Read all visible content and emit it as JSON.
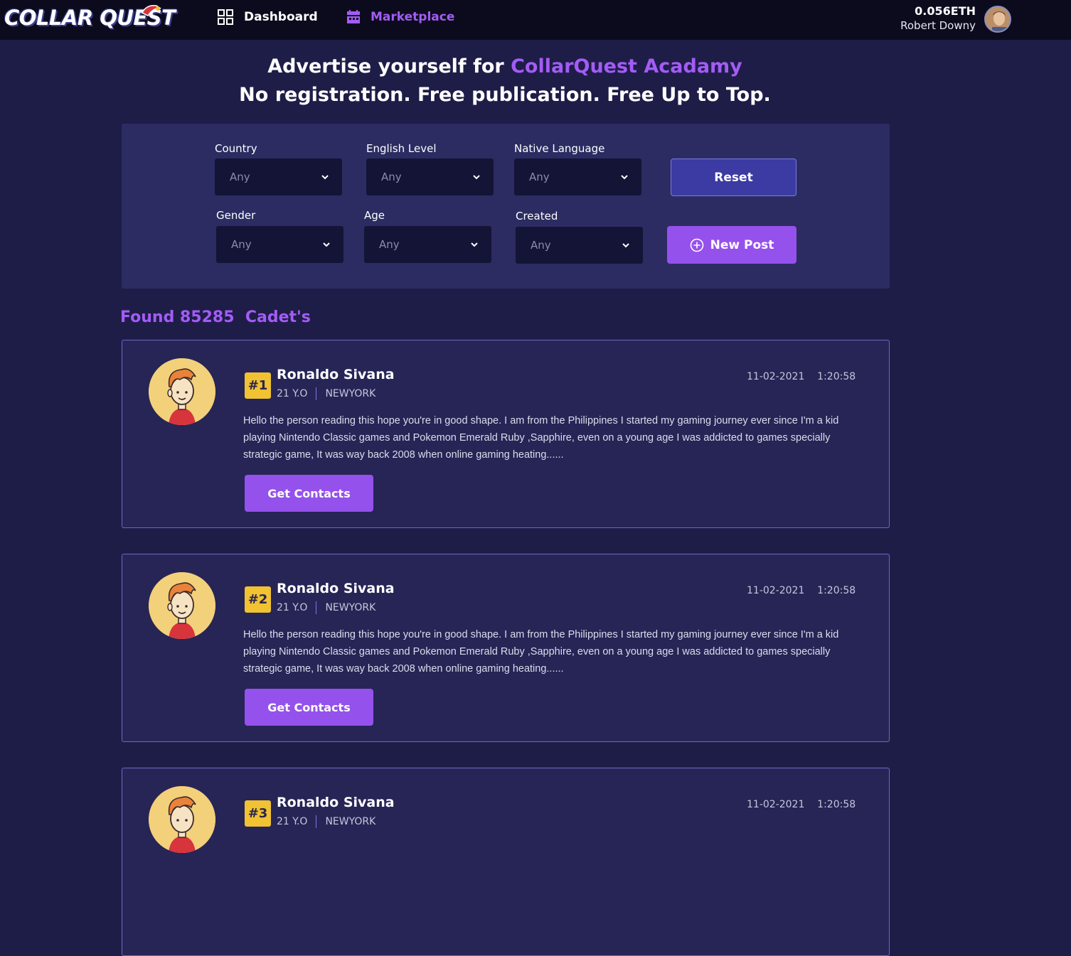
{
  "header": {
    "logo_text": "COLLAR QUEST",
    "nav": [
      {
        "label": "Dashboard",
        "icon": "grid-icon"
      },
      {
        "label": "Marketplace",
        "icon": "store-icon"
      }
    ],
    "balance": "0.056ETH",
    "user_name": "Robert Downy"
  },
  "hero": {
    "line1_prefix": "Advertise yourself for ",
    "line1_accent": "CollarQuest Acadamy",
    "line2": "No registration. Free publication. Free Up to Top."
  },
  "filters": {
    "country": {
      "label": "Country",
      "value": "Any"
    },
    "english": {
      "label": "English Level",
      "value": "Any"
    },
    "native": {
      "label": "Native Language",
      "value": "Any"
    },
    "gender": {
      "label": "Gender",
      "value": "Any"
    },
    "age": {
      "label": "Age",
      "value": "Any"
    },
    "created": {
      "label": "Created",
      "value": "Any"
    },
    "reset_label": "Reset",
    "new_post_label": "New Post"
  },
  "results": {
    "found_text": "Found 85285  Cadet's"
  },
  "cards": [
    {
      "rank": "#1",
      "name": "Ronaldo Sivana",
      "age": "21 Y.O",
      "city": "NEWYORK",
      "date": "11-02-2021    1:20:58",
      "description": "Hello the person reading this hope you're in good shape. I am from the Philippines I started my gaming journey ever since I'm a kid playing Nintendo Classic games and Pokemon Emerald Ruby ,Sapphire, even on a young age I was addicted to games specially strategic game, It was way back 2008 when online gaming heating......",
      "button": "Get Contacts"
    },
    {
      "rank": "#2",
      "name": "Ronaldo Sivana",
      "age": "21 Y.O",
      "city": "NEWYORK",
      "date": "11-02-2021    1:20:58",
      "description": "Hello the person reading this hope you're in good shape. I am from the Philippines I started my gaming journey ever since I'm a kid playing Nintendo Classic games and Pokemon Emerald Ruby ,Sapphire, even on a young age I was addicted to games specially strategic game, It was way back 2008 when online gaming heating......",
      "button": "Get Contacts"
    },
    {
      "rank": "#3",
      "name": "Ronaldo Sivana",
      "age": "21 Y.O",
      "city": "NEWYORK",
      "date": "11-02-2021    1:20:58",
      "description": "",
      "button": ""
    }
  ],
  "colors": {
    "background": "#1e1d48",
    "topbar": "#0c0b1e",
    "accent": "#a35cf5",
    "panel": "#2c2c62",
    "rank_badge": "#f1c232"
  }
}
